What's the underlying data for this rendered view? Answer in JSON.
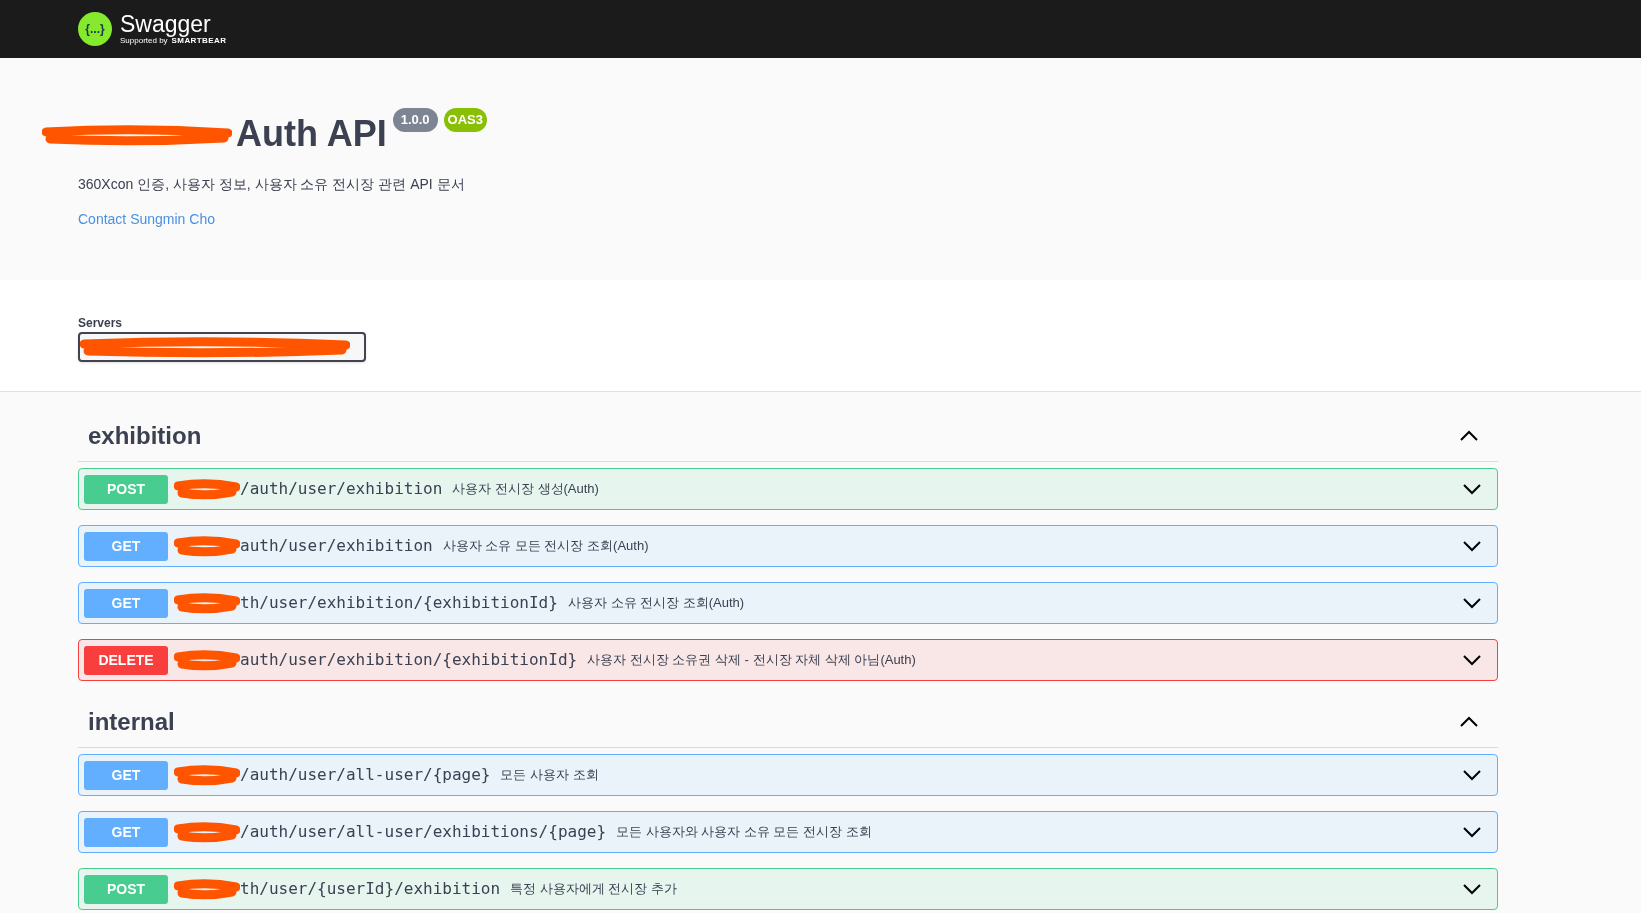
{
  "header": {
    "logo_glyph": "{...}",
    "brand": "Swagger",
    "supported_by": "Supported by",
    "company": "SMARTBEAR"
  },
  "info": {
    "title": "Auth API",
    "version": "1.0.0",
    "spec": "OAS3",
    "description": "360Xcon 인증, 사용자 정보, 사용자 소유 전시장 관련 API 문서",
    "contact": "Contact Sungmin Cho"
  },
  "servers": {
    "label": "Servers"
  },
  "sections": [
    {
      "name": "exhibition",
      "expanded": true,
      "operations": [
        {
          "method": "POST",
          "path": "/auth/user/exhibition",
          "summary": "사용자 전시장 생성(Auth)",
          "expanded": false
        },
        {
          "method": "GET",
          "path": "auth/user/exhibition",
          "summary": "사용자 소유 모든 전시장 조회(Auth)",
          "expanded": false
        },
        {
          "method": "GET",
          "path": "th/user/exhibition/{exhibitionId}",
          "summary": "사용자 소유 전시장 조회(Auth)",
          "expanded": false
        },
        {
          "method": "DELETE",
          "path": "auth/user/exhibition/{exhibitionId}",
          "summary": "사용자 전시장 소유권 삭제 - 전시장 자체 삭제 아님(Auth)",
          "expanded": false
        }
      ]
    },
    {
      "name": "internal",
      "expanded": true,
      "operations": [
        {
          "method": "GET",
          "path": "/auth/user/all-user/{page}",
          "summary": "모든 사용자 조회",
          "expanded": false
        },
        {
          "method": "GET",
          "path": "/auth/user/all-user/exhibitions/{page}",
          "summary": "모든 사용자와 사용자 소유 모든 전시장 조회",
          "expanded": false
        },
        {
          "method": "POST",
          "path": "th/user/{userId}/exhibition",
          "summary": "특정 사용자에게 전시장 추가",
          "expanded": false
        }
      ]
    }
  ]
}
